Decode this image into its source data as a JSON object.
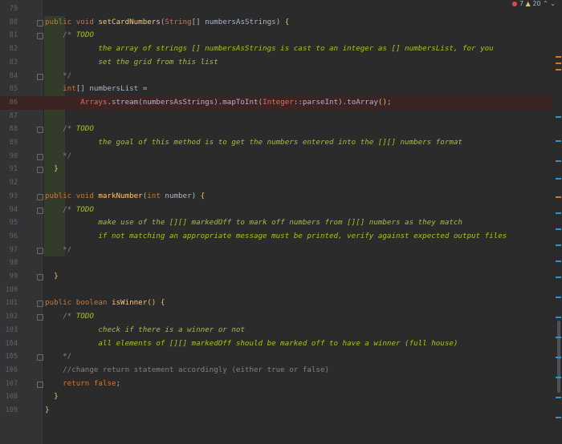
{
  "status": {
    "errors": "7",
    "warnings": "20"
  },
  "lines": [
    {
      "n": "79",
      "parts": []
    },
    {
      "n": "80",
      "parts": [
        [
          "kw",
          "public void "
        ],
        [
          "fn",
          "setCardNumbers"
        ],
        [
          "cls",
          "("
        ],
        [
          "red",
          "String"
        ],
        [
          "cls",
          "[] numbersAsStrings) "
        ],
        [
          "brace",
          "{"
        ]
      ]
    },
    {
      "n": "81",
      "parts": [
        [
          "cls",
          "    "
        ],
        [
          "cm",
          "/* "
        ],
        [
          "todo",
          "TODO"
        ]
      ]
    },
    {
      "n": "82",
      "parts": [
        [
          "todo",
          "            the array of strings [] numbersAsStrings is cast to an integer as [] numbersList, for you"
        ]
      ]
    },
    {
      "n": "83",
      "parts": [
        [
          "todo",
          "            set the grid from this list"
        ]
      ]
    },
    {
      "n": "84",
      "parts": [
        [
          "cm",
          "    */"
        ]
      ]
    },
    {
      "n": "85",
      "parts": [
        [
          "kw",
          "    int"
        ],
        [
          "cls",
          "[] numbersList ="
        ]
      ]
    },
    {
      "n": "86",
      "parts": [
        [
          "red",
          "        Arrays"
        ],
        [
          "cls",
          ".stream(numbersAsStrings).mapToInt("
        ],
        [
          "red",
          "Integer"
        ],
        [
          "cls",
          "::parseInt).toArray"
        ],
        [
          "brace",
          "()"
        ],
        [
          "cls",
          ";"
        ]
      ]
    },
    {
      "n": "87",
      "parts": []
    },
    {
      "n": "88",
      "parts": [
        [
          "cm",
          "    /* "
        ],
        [
          "todo",
          "TODO"
        ]
      ]
    },
    {
      "n": "89",
      "parts": [
        [
          "todo",
          "            the goal of this method is to get the numbers entered into the [][] numbers format"
        ]
      ]
    },
    {
      "n": "90",
      "parts": [
        [
          "cm",
          "    */"
        ]
      ]
    },
    {
      "n": "91",
      "parts": [
        [
          "brace",
          "  }"
        ]
      ]
    },
    {
      "n": "92",
      "parts": []
    },
    {
      "n": "93",
      "parts": [
        [
          "kw",
          "public void "
        ],
        [
          "fn",
          "markNumber"
        ],
        [
          "cls",
          "("
        ],
        [
          "kw",
          "int"
        ],
        [
          "cls",
          " number) "
        ],
        [
          "brace",
          "{"
        ]
      ]
    },
    {
      "n": "94",
      "parts": [
        [
          "cm",
          "    /* "
        ],
        [
          "todo",
          "TODO"
        ]
      ]
    },
    {
      "n": "95",
      "parts": [
        [
          "todo",
          "            make use of the [][] markedOff to mark off numbers from [][] numbers as they match"
        ]
      ]
    },
    {
      "n": "96",
      "parts": [
        [
          "todo",
          "            if not matching an appropriate message must be printed, verify against expected output files"
        ]
      ]
    },
    {
      "n": "97",
      "parts": [
        [
          "cm",
          "    */"
        ]
      ]
    },
    {
      "n": "98",
      "parts": []
    },
    {
      "n": "99",
      "parts": [
        [
          "brace",
          "  }"
        ]
      ]
    },
    {
      "n": "100",
      "parts": []
    },
    {
      "n": "101",
      "parts": [
        [
          "kw",
          "public boolean "
        ],
        [
          "fn",
          "isWinner"
        ],
        [
          "brace",
          "()"
        ],
        [
          "cls",
          " "
        ],
        [
          "brace",
          "{"
        ]
      ]
    },
    {
      "n": "102",
      "parts": [
        [
          "cm",
          "    /* "
        ],
        [
          "todo",
          "TODO"
        ]
      ]
    },
    {
      "n": "103",
      "parts": [
        [
          "todo",
          "            check if there is a winner or not"
        ]
      ]
    },
    {
      "n": "104",
      "parts": [
        [
          "todo",
          "            all elements of [][] markedOff should be marked off to have a winner (full house)"
        ]
      ]
    },
    {
      "n": "105",
      "parts": [
        [
          "cm",
          "    */"
        ]
      ]
    },
    {
      "n": "106",
      "parts": [
        [
          "cm",
          "    //change return statement accordingly (either true or false)"
        ]
      ]
    },
    {
      "n": "107",
      "parts": [
        [
          "kw",
          "    return false"
        ],
        [
          "cls",
          ";"
        ]
      ]
    },
    {
      "n": "108",
      "parts": [
        [
          "brace",
          "  }"
        ]
      ]
    },
    {
      "n": "109",
      "parts": [
        [
          "brace",
          "}"
        ]
      ]
    }
  ]
}
